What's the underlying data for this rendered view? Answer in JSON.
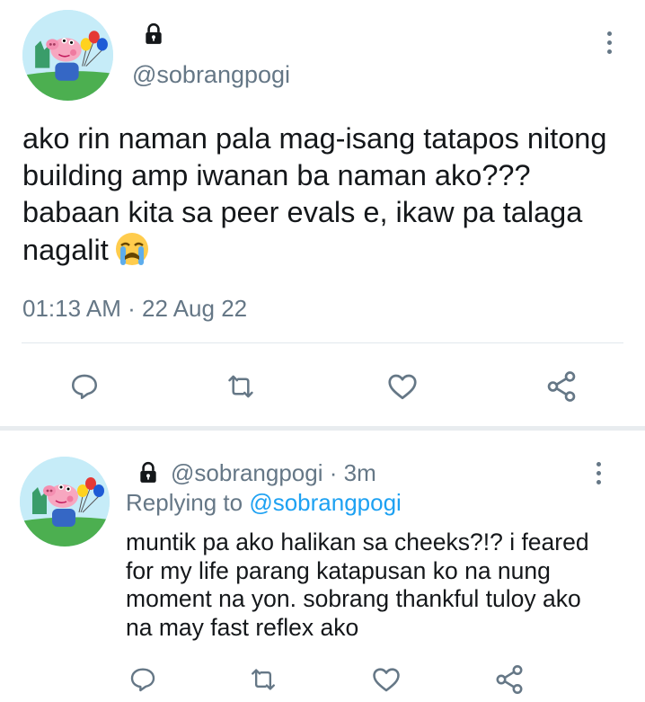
{
  "main_tweet": {
    "handle": "@sobrangpogi",
    "text": "ako rin naman pala mag-isang tatapos nitong building amp iwanan ba naman ako??? babaan kita sa peer evals e, ikaw pa talaga nagalit",
    "emoji": "loudly-crying-face",
    "time": "01:13 AM",
    "separator": "·",
    "date": "22 Aug 22",
    "protected_icon": "lock-icon",
    "actions": [
      "reply-icon",
      "retweet-icon",
      "like-icon",
      "share-icon"
    ]
  },
  "reply_tweet": {
    "handle": "@sobrangpogi",
    "separator": "·",
    "time_ago": "3m",
    "replying_prefix": "Replying to",
    "replying_to": "@sobrangpogi",
    "text": "muntik pa ako halikan sa cheeks?!? i feared for my life parang katapusan ko na nung moment na yon. sobrang thankful tuloy ako na may fast reflex ako",
    "protected_icon": "lock-icon",
    "actions": [
      "reply-icon",
      "retweet-icon",
      "like-icon",
      "share-icon"
    ]
  },
  "colors": {
    "text": "#14171a",
    "secondary": "#657786",
    "link": "#1da1f2",
    "divider": "#e1e8ed",
    "separator_band": "#e8ecef",
    "avatar_sky": "#c6ecf8",
    "avatar_grass": "#4caf50"
  }
}
